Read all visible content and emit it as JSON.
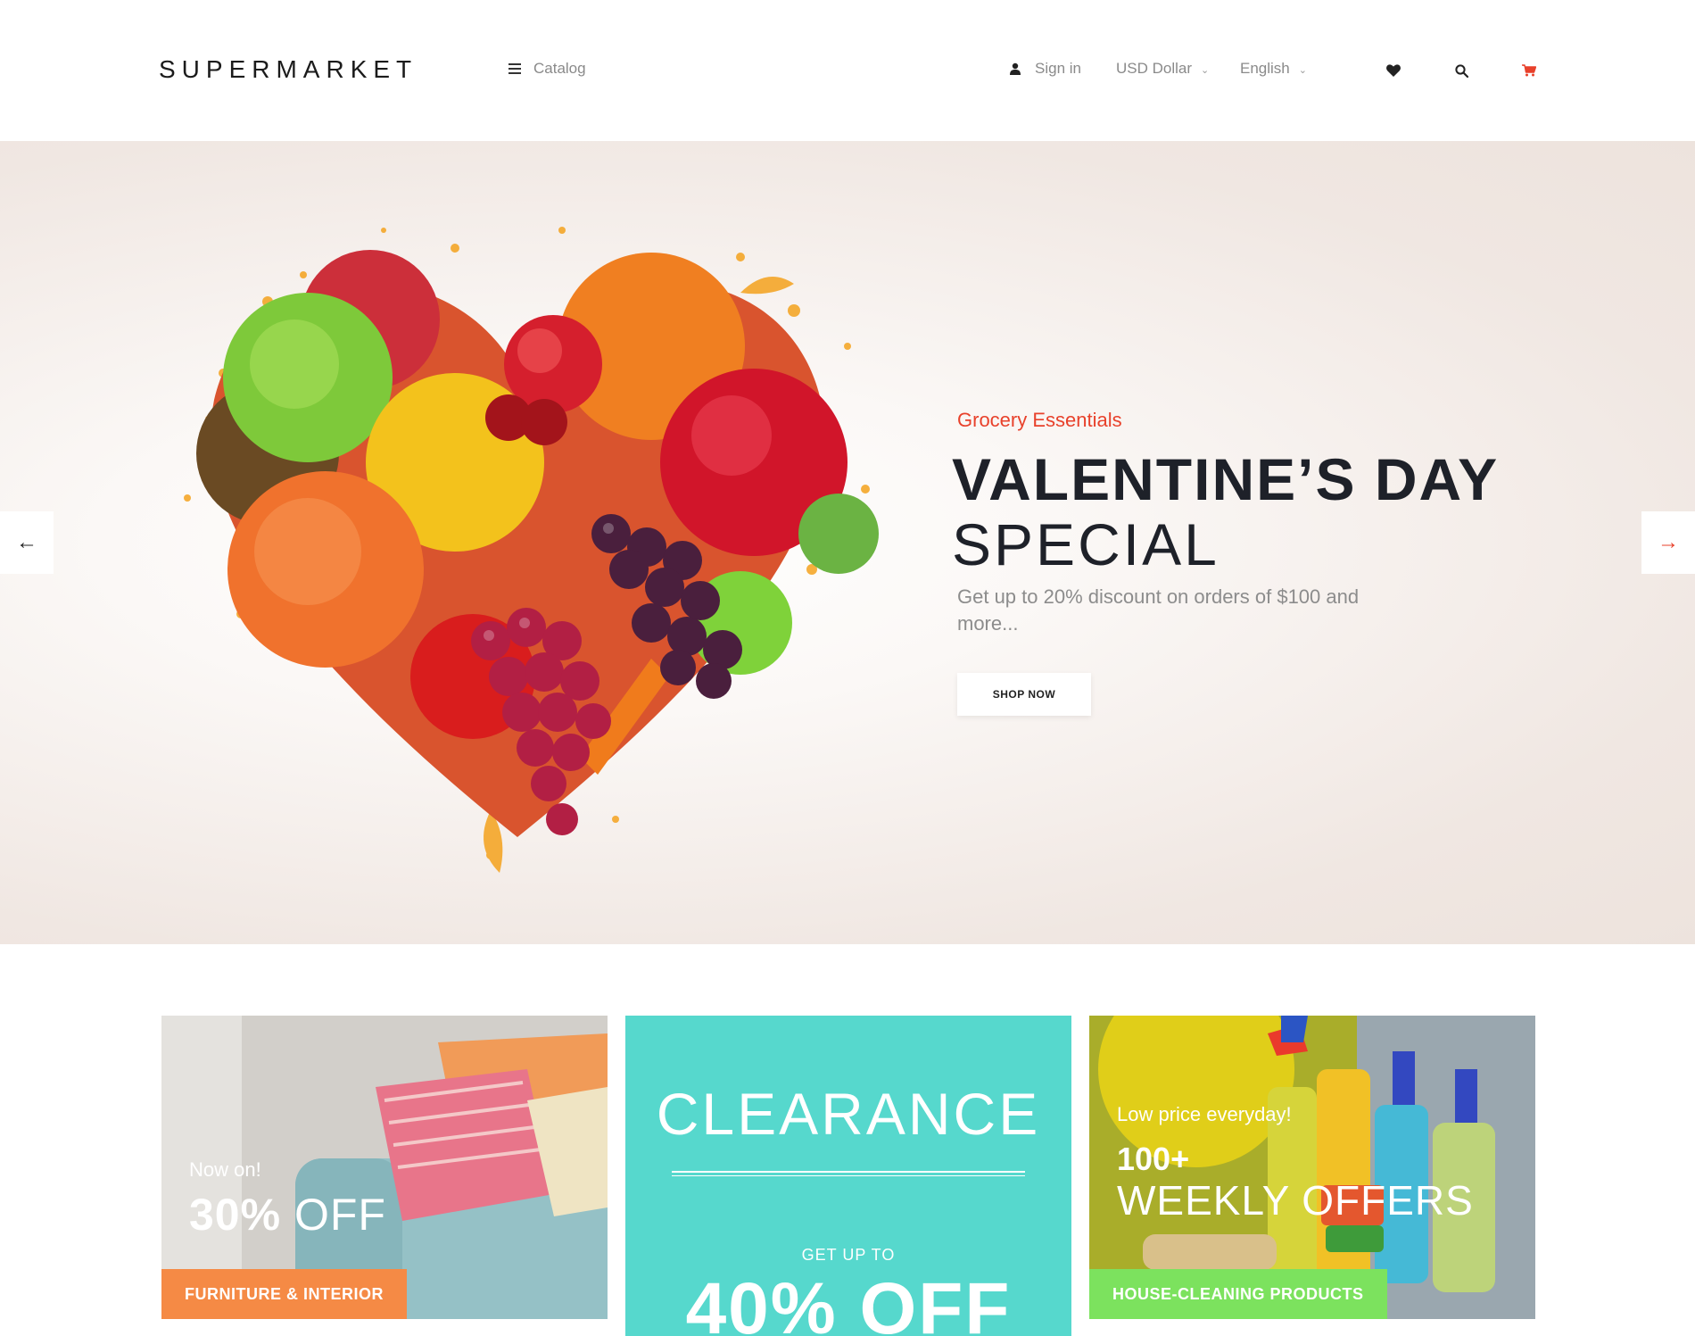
{
  "header": {
    "logo": "SUPERMARKET",
    "catalog_label": "Catalog",
    "signin_label": "Sign in",
    "currency": "USD Dollar",
    "language": "English",
    "icons": [
      "user-icon",
      "heart-icon",
      "search-icon",
      "cart-icon"
    ]
  },
  "hero": {
    "eyebrow": "Grocery Essentials",
    "title_line1": "VALENTINE’S DAY",
    "title_line2": "SPECIAL",
    "subtitle": "Get up to 20% discount on orders of $100 and more...",
    "button_label": "SHOP NOW",
    "prev_arrow": "←",
    "next_arrow": "→"
  },
  "banners": {
    "furniture": {
      "small": "Now on!",
      "big_bold": "30%",
      "big_rest": "OFF",
      "tag": "FURNITURE & INTERIOR"
    },
    "clearance": {
      "title": "CLEARANCE",
      "small": "GET UP TO",
      "big": "40% OFF"
    },
    "cleaning": {
      "small": "Low price everyday!",
      "number": "100+",
      "big": "WEEKLY OFFERS",
      "tag": "HOUSE-CLEANING PRODUCTS"
    }
  },
  "colors": {
    "accent_red": "#e8412b",
    "clearance_teal": "#56d8cd",
    "furniture_orange": "#f58a45",
    "cleaning_green": "#7ce25e"
  }
}
